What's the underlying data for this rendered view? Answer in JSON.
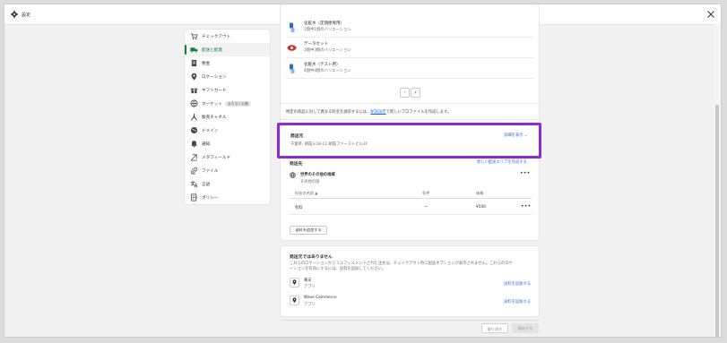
{
  "window": {
    "title": "設定"
  },
  "sidebar": {
    "items": [
      {
        "label": "チェックアウト",
        "icon": "cart-icon"
      },
      {
        "label": "配送と配達",
        "icon": "truck-icon",
        "active": true
      },
      {
        "label": "税金",
        "icon": "tax-receipt-icon"
      },
      {
        "label": "ロケーション",
        "icon": "location-pin-icon"
      },
      {
        "label": "ギフトカード",
        "icon": "gift-icon"
      },
      {
        "label": "マーケット",
        "icon": "globe-icon",
        "badge": "まもなく公開"
      },
      {
        "label": "販売チャネル",
        "icon": "channels-icon"
      },
      {
        "label": "ドメイン",
        "icon": "globe-alt-icon"
      },
      {
        "label": "通知",
        "icon": "bell-icon"
      },
      {
        "label": "メタフィールド",
        "icon": "metafield-icon"
      },
      {
        "label": "ファイル",
        "icon": "paperclip-icon"
      },
      {
        "label": "言語",
        "icon": "language-icon"
      },
      {
        "label": "ポリシー",
        "icon": "policy-doc-icon"
      }
    ]
  },
  "products": [
    {
      "name": "化粧水（定期便専用）",
      "variants": "1個中1個のバリエーション"
    },
    {
      "name": "データセット",
      "variants": "3個中3個のバリエーション"
    },
    {
      "name": "化粧水（テスト用）",
      "variants": "4個中4個のバリエーション"
    }
  ],
  "pager": {
    "prev": "‹",
    "next": "›"
  },
  "note": {
    "before": "特定の商品に対して異なる料金を請求するには、",
    "link": "配送設定",
    "after": "で新しいプロファイルを作成します。"
  },
  "ship_from": {
    "title": "発送元",
    "address": "千葉県, 朝霞3-18-11 朝霞ファーストビル3F",
    "toggle": "詳細を表示"
  },
  "ship_to": {
    "title": "発送先",
    "create_zone": "新しい配送エリアを作成する",
    "zone_name": "世界のその他の地域",
    "zone_sub": "その他の国",
    "columns": {
      "name": "料金の名前",
      "condition": "条件",
      "price": "価格"
    },
    "rates": [
      {
        "name": "有料",
        "condition": "—",
        "price": "¥500"
      }
    ],
    "add_rate": "送料を追加する"
  },
  "not_ship_from": {
    "title": "発送元ではありません",
    "desc_1": "これらのロケーションからフルフィルメントされた注文は、チェックアウト時に配送オプションが表示されません。これらのロケ",
    "desc_2": "ーションを有効にするには、送料を追加してください。",
    "locations": [
      {
        "name": "楽天",
        "sub": "アプリ",
        "action": "送料を追加する"
      },
      {
        "name": "Wave Commerce",
        "sub": "アプリ",
        "action": "送料を追加する"
      }
    ]
  },
  "footer": {
    "discard": "取り消す",
    "save": "保存する"
  },
  "colors": {
    "accent": "#1a7a3e",
    "link": "#2c6ecb",
    "highlight": "#8a2bd6"
  }
}
